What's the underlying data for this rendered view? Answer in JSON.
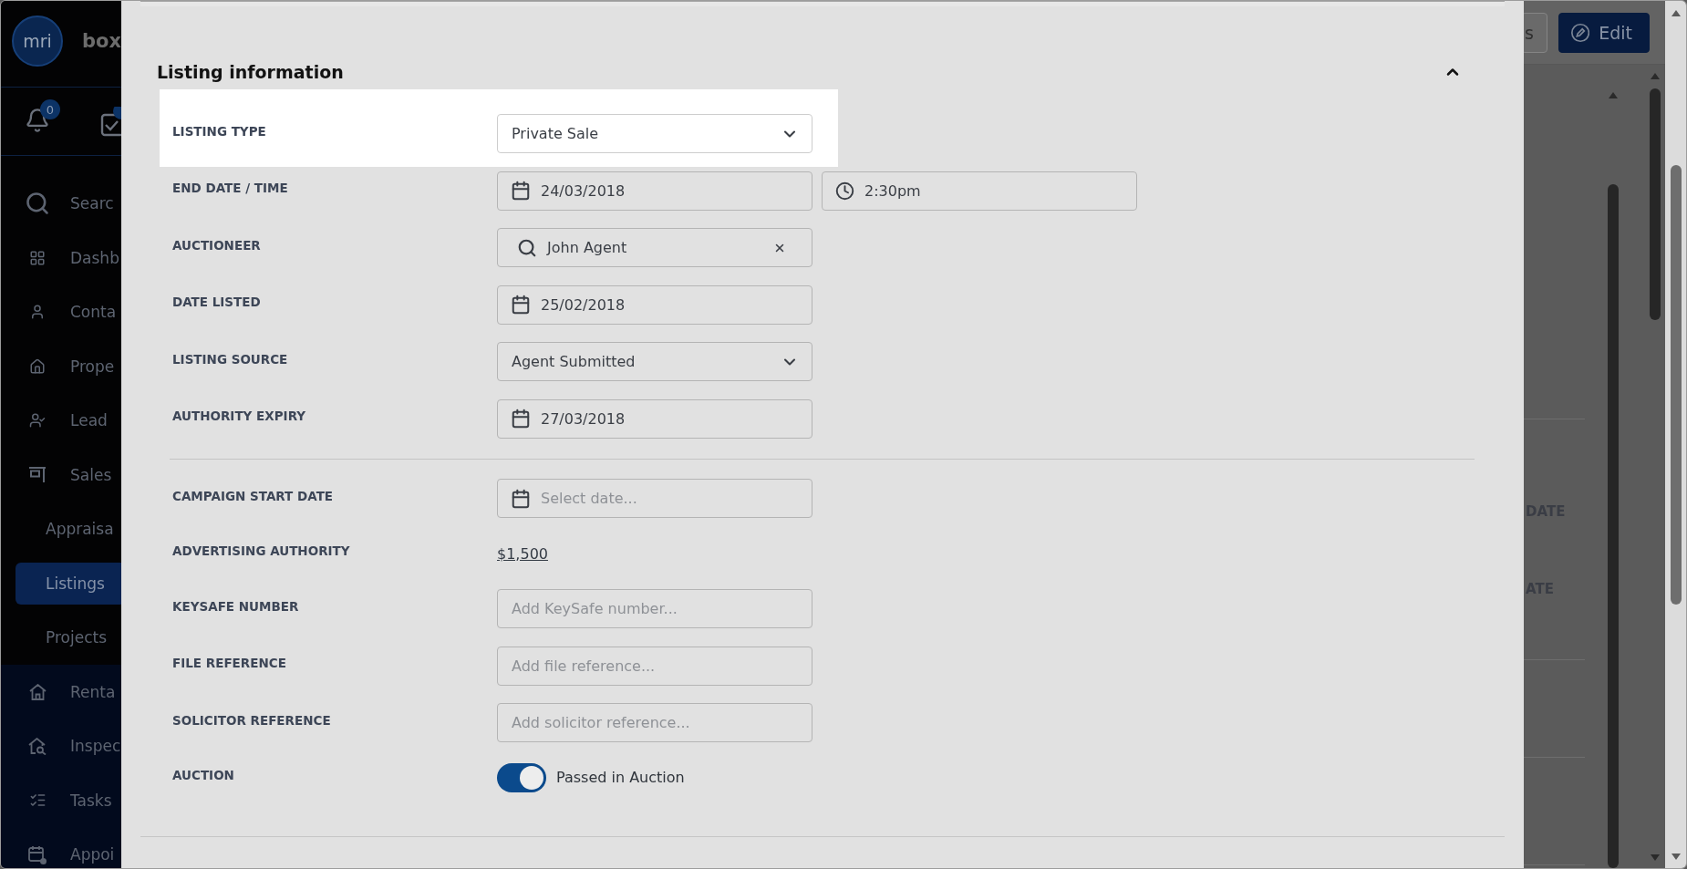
{
  "sidebar": {
    "logo": "mri",
    "brand": "box",
    "badge": "0",
    "items": [
      {
        "label": "Searc",
        "selected": false
      },
      {
        "label": "Dashb",
        "selected": false
      },
      {
        "label": "Conta",
        "selected": false
      },
      {
        "label": "Prope",
        "selected": false
      },
      {
        "label": "Lead",
        "selected": false
      },
      {
        "label": "Sales",
        "selected": false,
        "children": [
          {
            "label": "Appraisa",
            "selected": false
          },
          {
            "label": "Listings",
            "selected": true
          },
          {
            "label": "Projects",
            "selected": false
          }
        ]
      },
      {
        "label": "Renta",
        "selected": false
      },
      {
        "label": "Inspec",
        "selected": false
      },
      {
        "label": "Tasks",
        "selected": false
      },
      {
        "label": "Appoi",
        "selected": false
      }
    ]
  },
  "header": {
    "buttons": [
      {
        "label": "s",
        "kind": "secondary"
      },
      {
        "label": "Edit",
        "kind": "primary"
      }
    ]
  },
  "details_panel": {
    "labels": [
      "DATE",
      "ATE"
    ]
  },
  "modal": {
    "section": {
      "title": "Listing information",
      "expanded": true,
      "groups": [
        {
          "fields": [
            {
              "label": "LISTING TYPE",
              "kind": "select",
              "value": "Private Sale",
              "highlighted": true
            },
            {
              "label": "END DATE / TIME",
              "kind": "datetime",
              "value": "24/03/2018",
              "time": "2:30pm",
              "highlighted": false
            },
            {
              "label": "AUCTIONEER",
              "kind": "search",
              "value": "John Agent",
              "highlighted": false
            },
            {
              "label": "DATE LISTED",
              "kind": "date",
              "value": "25/02/2018",
              "highlighted": false
            },
            {
              "label": "LISTING SOURCE",
              "kind": "select",
              "value": "Agent Submitted",
              "highlighted": false
            },
            {
              "label": "AUTHORITY EXPIRY",
              "kind": "date",
              "value": "27/03/2018",
              "highlighted": false
            }
          ]
        },
        {
          "fields": [
            {
              "label": "CAMPAIGN START DATE",
              "kind": "date",
              "placeholder": "Select date...",
              "highlighted": false
            },
            {
              "label": "ADVERTISING AUTHORITY",
              "kind": "link",
              "value": "$1,500",
              "highlighted": false
            },
            {
              "label": "KEYSAFE NUMBER",
              "kind": "text",
              "placeholder": "Add KeySafe number...",
              "highlighted": false
            },
            {
              "label": "FILE REFERENCE",
              "kind": "text",
              "placeholder": "Add file reference...",
              "highlighted": false
            },
            {
              "label": "SOLICITOR REFERENCE",
              "kind": "text",
              "placeholder": "Add solicitor reference...",
              "highlighted": false
            },
            {
              "label": "AUCTION",
              "kind": "toggle",
              "on": true,
              "text": "Passed in Auction",
              "highlighted": false
            }
          ]
        }
      ]
    }
  }
}
